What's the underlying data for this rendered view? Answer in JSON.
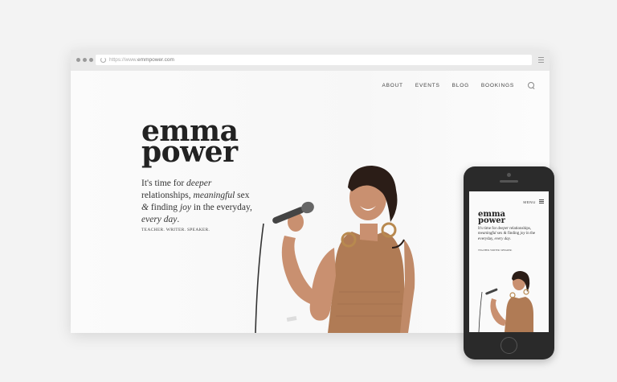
{
  "browser": {
    "url_prefix": "https://www.",
    "url_domain": "emmpower.com"
  },
  "nav": {
    "items": [
      "ABOUT",
      "EVENTS",
      "BLOG",
      "BOOKINGS"
    ]
  },
  "hero": {
    "logo_line1": "emma",
    "logo_line2": "power",
    "tagline": {
      "p1": "It's time for ",
      "i1": "deeper",
      "p2": " relationships, ",
      "i2": "meaningful",
      "p3": " sex ",
      "i3": "&",
      "p4": " finding ",
      "i4": "joy",
      "p5": " in the everyday, ",
      "i5": "every day",
      "p6": "."
    },
    "roles": "TEACHER. WRITER. SPEAKER."
  },
  "mobile": {
    "menu_label": "MENU",
    "logo_line1": "emma",
    "logo_line2": "power",
    "roles": "TEACHER. WRITER. SPEAKER."
  },
  "colors": {
    "text_dark": "#222222",
    "dress": "#b07b55",
    "skin": "#c99070",
    "hair": "#2b1d17"
  },
  "icons": [
    "browser-dots-icon",
    "reload-icon",
    "menu-lines-icon",
    "search-icon",
    "hamburger-icon",
    "home-button-icon"
  ]
}
